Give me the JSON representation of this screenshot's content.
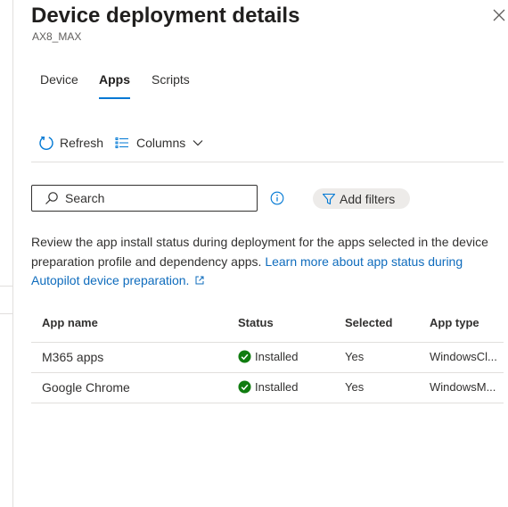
{
  "panel": {
    "title": "Device deployment details",
    "subtitle": "AX8_MAX"
  },
  "tabs": [
    {
      "label": "Device",
      "selected": false
    },
    {
      "label": "Apps",
      "selected": true
    },
    {
      "label": "Scripts",
      "selected": false
    }
  ],
  "toolbar": {
    "refresh_label": "Refresh",
    "columns_label": "Columns"
  },
  "search": {
    "placeholder": "Search"
  },
  "filters": {
    "add_label": "Add filters"
  },
  "description": {
    "text": "Review the app install status during deployment for the apps selected in the device preparation profile and dependency apps. ",
    "link_text": "Learn more about app status during Autopilot device preparation."
  },
  "table": {
    "headers": {
      "name": "App name",
      "status": "Status",
      "selected": "Selected",
      "type": "App type"
    },
    "rows": [
      {
        "name": "M365 apps",
        "status": "Installed",
        "selected": "Yes",
        "type": "WindowsCl..."
      },
      {
        "name": "Google Chrome",
        "status": "Installed",
        "selected": "Yes",
        "type": "WindowsM..."
      }
    ]
  },
  "colors": {
    "accent": "#0078d4",
    "link": "#0f6cbd",
    "success": "#107c10"
  }
}
